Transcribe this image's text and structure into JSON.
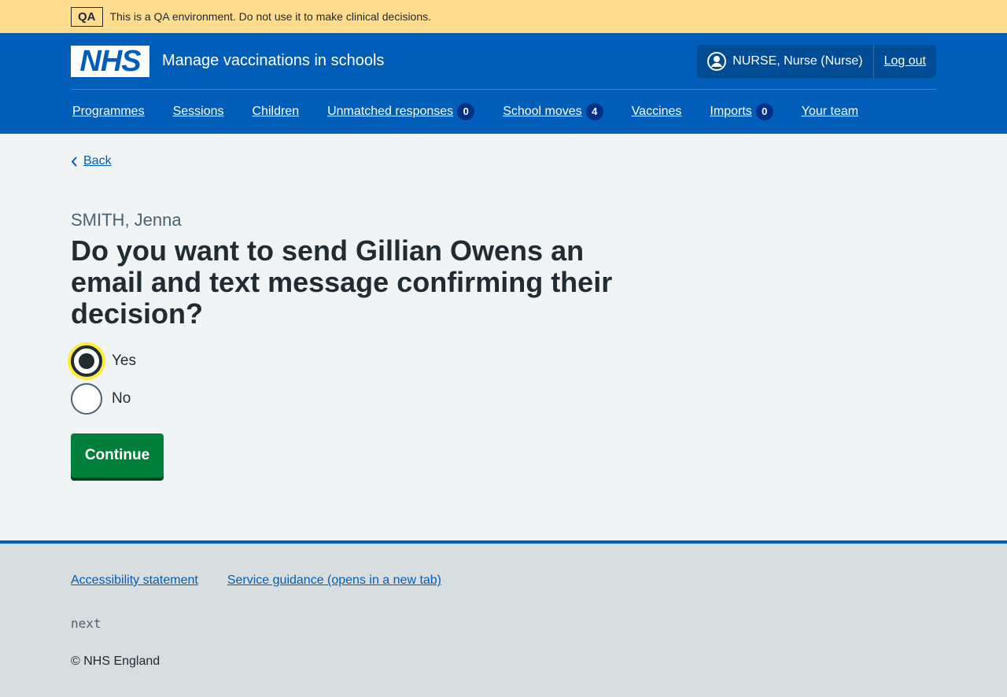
{
  "qa_banner": {
    "tag": "QA",
    "message": "This is a QA environment. Do not use it to make clinical decisions."
  },
  "header": {
    "logo_text": "NHS",
    "service_name": "Manage vaccinations in schools",
    "user_name": "NURSE, Nurse (Nurse)",
    "logout_label": "Log out"
  },
  "nav": {
    "items": [
      {
        "label": "Programmes"
      },
      {
        "label": "Sessions"
      },
      {
        "label": "Children"
      },
      {
        "label": "Unmatched responses",
        "count": "0"
      },
      {
        "label": "School moves",
        "count": "4"
      },
      {
        "label": "Vaccines"
      },
      {
        "label": "Imports",
        "count": "0"
      },
      {
        "label": "Your team"
      }
    ]
  },
  "main": {
    "back_label": "Back",
    "caption": "SMITH, Jenna",
    "question": "Do you want to send Gillian Owens an email and text message confirming their decision?",
    "options": [
      {
        "label": "Yes",
        "checked": true
      },
      {
        "label": "No",
        "checked": false
      }
    ],
    "continue_label": "Continue"
  },
  "footer": {
    "links": [
      {
        "label": "Accessibility statement"
      },
      {
        "label": "Service guidance (opens in a new tab)"
      }
    ],
    "version": "next",
    "copyright": "© NHS England"
  },
  "colors": {
    "nhs_blue": "#005eb8",
    "qa_banner": "#ffdc8e",
    "button_green": "#007f3b",
    "focus_yellow": "#ffeb3b"
  }
}
